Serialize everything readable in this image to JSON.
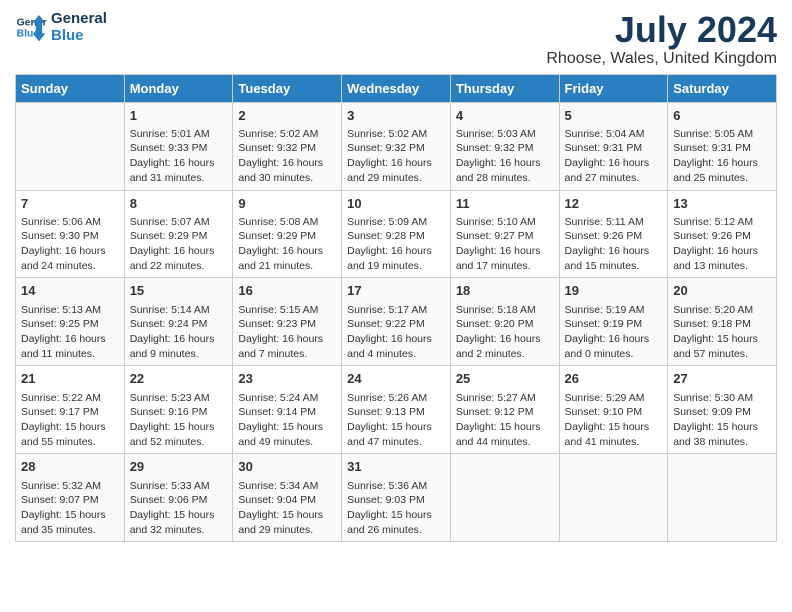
{
  "logo": {
    "line1": "General",
    "line2": "Blue"
  },
  "title": "July 2024",
  "location": "Rhoose, Wales, United Kingdom",
  "weekdays": [
    "Sunday",
    "Monday",
    "Tuesday",
    "Wednesday",
    "Thursday",
    "Friday",
    "Saturday"
  ],
  "weeks": [
    [
      {
        "day": "",
        "info": ""
      },
      {
        "day": "1",
        "info": "Sunrise: 5:01 AM\nSunset: 9:33 PM\nDaylight: 16 hours\nand 31 minutes."
      },
      {
        "day": "2",
        "info": "Sunrise: 5:02 AM\nSunset: 9:32 PM\nDaylight: 16 hours\nand 30 minutes."
      },
      {
        "day": "3",
        "info": "Sunrise: 5:02 AM\nSunset: 9:32 PM\nDaylight: 16 hours\nand 29 minutes."
      },
      {
        "day": "4",
        "info": "Sunrise: 5:03 AM\nSunset: 9:32 PM\nDaylight: 16 hours\nand 28 minutes."
      },
      {
        "day": "5",
        "info": "Sunrise: 5:04 AM\nSunset: 9:31 PM\nDaylight: 16 hours\nand 27 minutes."
      },
      {
        "day": "6",
        "info": "Sunrise: 5:05 AM\nSunset: 9:31 PM\nDaylight: 16 hours\nand 25 minutes."
      }
    ],
    [
      {
        "day": "7",
        "info": "Sunrise: 5:06 AM\nSunset: 9:30 PM\nDaylight: 16 hours\nand 24 minutes."
      },
      {
        "day": "8",
        "info": "Sunrise: 5:07 AM\nSunset: 9:29 PM\nDaylight: 16 hours\nand 22 minutes."
      },
      {
        "day": "9",
        "info": "Sunrise: 5:08 AM\nSunset: 9:29 PM\nDaylight: 16 hours\nand 21 minutes."
      },
      {
        "day": "10",
        "info": "Sunrise: 5:09 AM\nSunset: 9:28 PM\nDaylight: 16 hours\nand 19 minutes."
      },
      {
        "day": "11",
        "info": "Sunrise: 5:10 AM\nSunset: 9:27 PM\nDaylight: 16 hours\nand 17 minutes."
      },
      {
        "day": "12",
        "info": "Sunrise: 5:11 AM\nSunset: 9:26 PM\nDaylight: 16 hours\nand 15 minutes."
      },
      {
        "day": "13",
        "info": "Sunrise: 5:12 AM\nSunset: 9:26 PM\nDaylight: 16 hours\nand 13 minutes."
      }
    ],
    [
      {
        "day": "14",
        "info": "Sunrise: 5:13 AM\nSunset: 9:25 PM\nDaylight: 16 hours\nand 11 minutes."
      },
      {
        "day": "15",
        "info": "Sunrise: 5:14 AM\nSunset: 9:24 PM\nDaylight: 16 hours\nand 9 minutes."
      },
      {
        "day": "16",
        "info": "Sunrise: 5:15 AM\nSunset: 9:23 PM\nDaylight: 16 hours\nand 7 minutes."
      },
      {
        "day": "17",
        "info": "Sunrise: 5:17 AM\nSunset: 9:22 PM\nDaylight: 16 hours\nand 4 minutes."
      },
      {
        "day": "18",
        "info": "Sunrise: 5:18 AM\nSunset: 9:20 PM\nDaylight: 16 hours\nand 2 minutes."
      },
      {
        "day": "19",
        "info": "Sunrise: 5:19 AM\nSunset: 9:19 PM\nDaylight: 16 hours\nand 0 minutes."
      },
      {
        "day": "20",
        "info": "Sunrise: 5:20 AM\nSunset: 9:18 PM\nDaylight: 15 hours\nand 57 minutes."
      }
    ],
    [
      {
        "day": "21",
        "info": "Sunrise: 5:22 AM\nSunset: 9:17 PM\nDaylight: 15 hours\nand 55 minutes."
      },
      {
        "day": "22",
        "info": "Sunrise: 5:23 AM\nSunset: 9:16 PM\nDaylight: 15 hours\nand 52 minutes."
      },
      {
        "day": "23",
        "info": "Sunrise: 5:24 AM\nSunset: 9:14 PM\nDaylight: 15 hours\nand 49 minutes."
      },
      {
        "day": "24",
        "info": "Sunrise: 5:26 AM\nSunset: 9:13 PM\nDaylight: 15 hours\nand 47 minutes."
      },
      {
        "day": "25",
        "info": "Sunrise: 5:27 AM\nSunset: 9:12 PM\nDaylight: 15 hours\nand 44 minutes."
      },
      {
        "day": "26",
        "info": "Sunrise: 5:29 AM\nSunset: 9:10 PM\nDaylight: 15 hours\nand 41 minutes."
      },
      {
        "day": "27",
        "info": "Sunrise: 5:30 AM\nSunset: 9:09 PM\nDaylight: 15 hours\nand 38 minutes."
      }
    ],
    [
      {
        "day": "28",
        "info": "Sunrise: 5:32 AM\nSunset: 9:07 PM\nDaylight: 15 hours\nand 35 minutes."
      },
      {
        "day": "29",
        "info": "Sunrise: 5:33 AM\nSunset: 9:06 PM\nDaylight: 15 hours\nand 32 minutes."
      },
      {
        "day": "30",
        "info": "Sunrise: 5:34 AM\nSunset: 9:04 PM\nDaylight: 15 hours\nand 29 minutes."
      },
      {
        "day": "31",
        "info": "Sunrise: 5:36 AM\nSunset: 9:03 PM\nDaylight: 15 hours\nand 26 minutes."
      },
      {
        "day": "",
        "info": ""
      },
      {
        "day": "",
        "info": ""
      },
      {
        "day": "",
        "info": ""
      }
    ]
  ]
}
